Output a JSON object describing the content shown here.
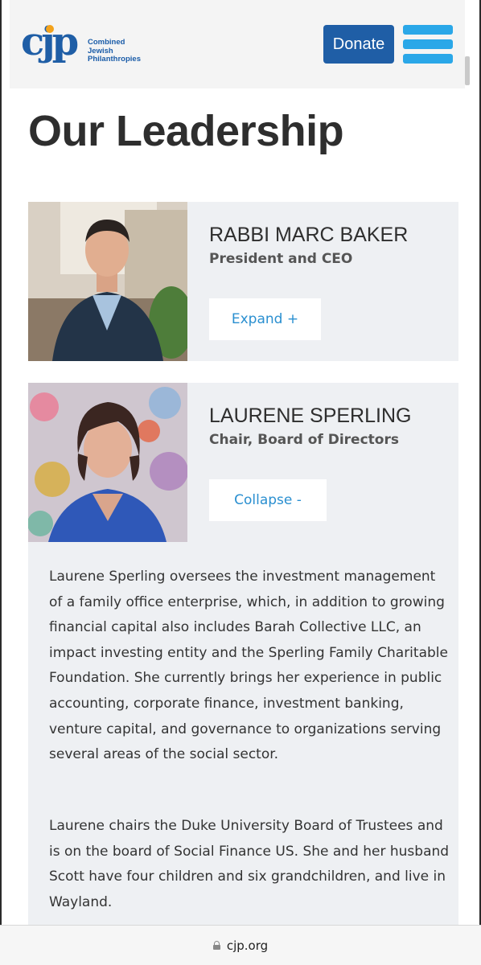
{
  "header": {
    "logo_mark": "cjp",
    "logo_lines": [
      "Combined",
      "Jewish",
      "Philanthropies"
    ],
    "donate_label": "Donate",
    "menu_icon": "hamburger-menu-icon"
  },
  "page": {
    "title": "Our Leadership"
  },
  "leaders": [
    {
      "name": "RABBI MARC BAKER",
      "role": "President and CEO",
      "toggle_label": "Expand +"
    },
    {
      "name": "LAURENE SPERLING",
      "role": "Chair, Board of Directors",
      "toggle_label": "Collapse -",
      "bio": [
        "Laurene Sperling oversees the investment management of a family office enterprise, which, in addition to growing financial capital also includes Barah Collective LLC, an impact investing entity and the Sperling Family Charitable Foundation. She currently brings her experience in public accounting, corporate finance, investment banking, venture capital, and governance to organizations serving several areas of the social sector.",
        "Laurene chairs the Duke University Board of Trustees and is on the board of Social Finance US. She and her husband Scott have four children and six grandchildren, and live in Wayland."
      ]
    }
  ],
  "browser": {
    "url": "cjp.org",
    "lock_icon": "lock-icon"
  },
  "colors": {
    "brand_blue": "#1f5ea6",
    "menu_blue": "#2aa7e8",
    "link_blue": "#2a8fd0",
    "card_bg": "#eef0f3",
    "logo_orange": "#f3a21b"
  }
}
